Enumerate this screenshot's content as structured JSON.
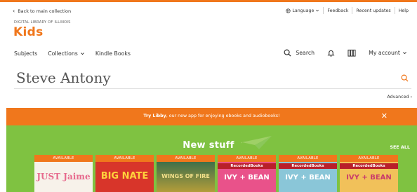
{
  "util": {
    "back": "Back to main collection",
    "language": "Language",
    "feedback": "Feedback",
    "recent_updates": "Recent updates",
    "help": "Help"
  },
  "brand": {
    "library": "DIGITAL LIBRARY OF ILLINOIS",
    "name": "Kids"
  },
  "nav": {
    "subjects": "Subjects",
    "collections": "Collections",
    "kindle_books": "Kindle Books",
    "search": "Search",
    "my_account": "My account"
  },
  "search": {
    "query": "Steve Antony",
    "advanced": "Advanced"
  },
  "banner": {
    "bold": "Try Libby",
    "text": ", our new app for enjoying ebooks and audiobooks!"
  },
  "new_stuff": {
    "title": "New stuff",
    "see_all": "SEE ALL",
    "books": [
      {
        "availability": "AVAILABLE",
        "title": "JUST Jaime",
        "cover_color": "#f7f2ea"
      },
      {
        "availability": "AVAILABLE",
        "title": "BIG NATE",
        "cover_color": "#d8352a"
      },
      {
        "availability": "AVAILABLE",
        "title": "WINGS OF FIRE",
        "cover_color": "#c7a437"
      },
      {
        "availability": "AVAILABLE",
        "publisher": "RecordedBooks",
        "title": "IVY + BEAN",
        "cover_color": "#e9528a"
      },
      {
        "availability": "AVAILABLE",
        "publisher": "RecordedBooks",
        "title": "IVY + BEAN",
        "cover_color": "#8ac6d8"
      },
      {
        "availability": "AVAILABLE",
        "publisher": "RecordedBooks",
        "title": "IVY + BEAN",
        "cover_color": "#f1c15a"
      }
    ]
  },
  "colors": {
    "brand_orange": "#f0771c",
    "new_stuff_green": "#7fc241",
    "recorded_books_red": "#b91f2a"
  }
}
